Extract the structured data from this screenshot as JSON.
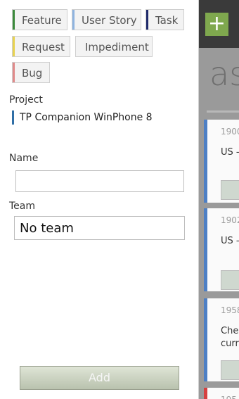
{
  "background": {
    "add_symbol": "+",
    "title_fragment": "as",
    "cards": [
      {
        "id": "1900",
        "text": "US -",
        "bar_color": "#4d7fc4"
      },
      {
        "id": "1902",
        "text": "US -",
        "bar_color": "#4d7fc4"
      },
      {
        "id": "1958",
        "text": "Chec",
        "text2": "curre",
        "bar_color": "#4d7fc4"
      },
      {
        "id": "195",
        "text": "",
        "bar_color": "#d64040"
      }
    ]
  },
  "types": [
    {
      "label": "Feature",
      "color": "#3c8a3c"
    },
    {
      "label": "User Story",
      "color": "#8fb4e0"
    },
    {
      "label": "Task",
      "color": "#1f2a6b"
    },
    {
      "label": "Request",
      "color": "#e7d250"
    },
    {
      "label": "Impediment",
      "color": ""
    },
    {
      "label": "Bug",
      "color": "#e08a8a"
    }
  ],
  "project": {
    "label": "Project",
    "value": "TP Companion WinPhone 8",
    "color": "#2f6ea6"
  },
  "name": {
    "label": "Name",
    "value": ""
  },
  "team": {
    "label": "Team",
    "value": "No team"
  },
  "add_button": "Add"
}
